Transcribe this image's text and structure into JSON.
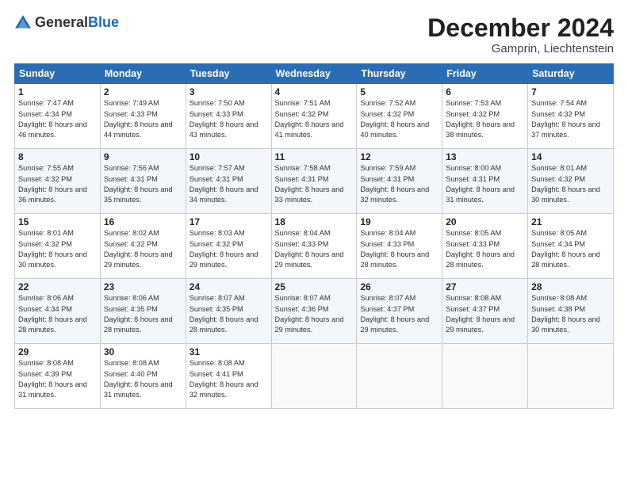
{
  "header": {
    "logo_general": "General",
    "logo_blue": "Blue",
    "month": "December 2024",
    "location": "Gamprin, Liechtenstein"
  },
  "days_of_week": [
    "Sunday",
    "Monday",
    "Tuesday",
    "Wednesday",
    "Thursday",
    "Friday",
    "Saturday"
  ],
  "weeks": [
    [
      {
        "day": "1",
        "detail": "Sunrise: 7:47 AM\nSunset: 4:34 PM\nDaylight: 8 hours and 46 minutes."
      },
      {
        "day": "2",
        "detail": "Sunrise: 7:49 AM\nSunset: 4:33 PM\nDaylight: 8 hours and 44 minutes."
      },
      {
        "day": "3",
        "detail": "Sunrise: 7:50 AM\nSunset: 4:33 PM\nDaylight: 8 hours and 43 minutes."
      },
      {
        "day": "4",
        "detail": "Sunrise: 7:51 AM\nSunset: 4:32 PM\nDaylight: 8 hours and 41 minutes."
      },
      {
        "day": "5",
        "detail": "Sunrise: 7:52 AM\nSunset: 4:32 PM\nDaylight: 8 hours and 40 minutes."
      },
      {
        "day": "6",
        "detail": "Sunrise: 7:53 AM\nSunset: 4:32 PM\nDaylight: 8 hours and 38 minutes."
      },
      {
        "day": "7",
        "detail": "Sunrise: 7:54 AM\nSunset: 4:32 PM\nDaylight: 8 hours and 37 minutes."
      }
    ],
    [
      {
        "day": "8",
        "detail": "Sunrise: 7:55 AM\nSunset: 4:32 PM\nDaylight: 8 hours and 36 minutes."
      },
      {
        "day": "9",
        "detail": "Sunrise: 7:56 AM\nSunset: 4:31 PM\nDaylight: 8 hours and 35 minutes."
      },
      {
        "day": "10",
        "detail": "Sunrise: 7:57 AM\nSunset: 4:31 PM\nDaylight: 8 hours and 34 minutes."
      },
      {
        "day": "11",
        "detail": "Sunrise: 7:58 AM\nSunset: 4:31 PM\nDaylight: 8 hours and 33 minutes."
      },
      {
        "day": "12",
        "detail": "Sunrise: 7:59 AM\nSunset: 4:31 PM\nDaylight: 8 hours and 32 minutes."
      },
      {
        "day": "13",
        "detail": "Sunrise: 8:00 AM\nSunset: 4:31 PM\nDaylight: 8 hours and 31 minutes."
      },
      {
        "day": "14",
        "detail": "Sunrise: 8:01 AM\nSunset: 4:32 PM\nDaylight: 8 hours and 30 minutes."
      }
    ],
    [
      {
        "day": "15",
        "detail": "Sunrise: 8:01 AM\nSunset: 4:32 PM\nDaylight: 8 hours and 30 minutes."
      },
      {
        "day": "16",
        "detail": "Sunrise: 8:02 AM\nSunset: 4:32 PM\nDaylight: 8 hours and 29 minutes."
      },
      {
        "day": "17",
        "detail": "Sunrise: 8:03 AM\nSunset: 4:32 PM\nDaylight: 8 hours and 29 minutes."
      },
      {
        "day": "18",
        "detail": "Sunrise: 8:04 AM\nSunset: 4:33 PM\nDaylight: 8 hours and 29 minutes."
      },
      {
        "day": "19",
        "detail": "Sunrise: 8:04 AM\nSunset: 4:33 PM\nDaylight: 8 hours and 28 minutes."
      },
      {
        "day": "20",
        "detail": "Sunrise: 8:05 AM\nSunset: 4:33 PM\nDaylight: 8 hours and 28 minutes."
      },
      {
        "day": "21",
        "detail": "Sunrise: 8:05 AM\nSunset: 4:34 PM\nDaylight: 8 hours and 28 minutes."
      }
    ],
    [
      {
        "day": "22",
        "detail": "Sunrise: 8:06 AM\nSunset: 4:34 PM\nDaylight: 8 hours and 28 minutes."
      },
      {
        "day": "23",
        "detail": "Sunrise: 8:06 AM\nSunset: 4:35 PM\nDaylight: 8 hours and 28 minutes."
      },
      {
        "day": "24",
        "detail": "Sunrise: 8:07 AM\nSunset: 4:35 PM\nDaylight: 8 hours and 28 minutes."
      },
      {
        "day": "25",
        "detail": "Sunrise: 8:07 AM\nSunset: 4:36 PM\nDaylight: 8 hours and 29 minutes."
      },
      {
        "day": "26",
        "detail": "Sunrise: 8:07 AM\nSunset: 4:37 PM\nDaylight: 8 hours and 29 minutes."
      },
      {
        "day": "27",
        "detail": "Sunrise: 8:08 AM\nSunset: 4:37 PM\nDaylight: 8 hours and 29 minutes."
      },
      {
        "day": "28",
        "detail": "Sunrise: 8:08 AM\nSunset: 4:38 PM\nDaylight: 8 hours and 30 minutes."
      }
    ],
    [
      {
        "day": "29",
        "detail": "Sunrise: 8:08 AM\nSunset: 4:39 PM\nDaylight: 8 hours and 31 minutes."
      },
      {
        "day": "30",
        "detail": "Sunrise: 8:08 AM\nSunset: 4:40 PM\nDaylight: 8 hours and 31 minutes."
      },
      {
        "day": "31",
        "detail": "Sunrise: 8:08 AM\nSunset: 4:41 PM\nDaylight: 8 hours and 32 minutes."
      },
      null,
      null,
      null,
      null
    ]
  ]
}
